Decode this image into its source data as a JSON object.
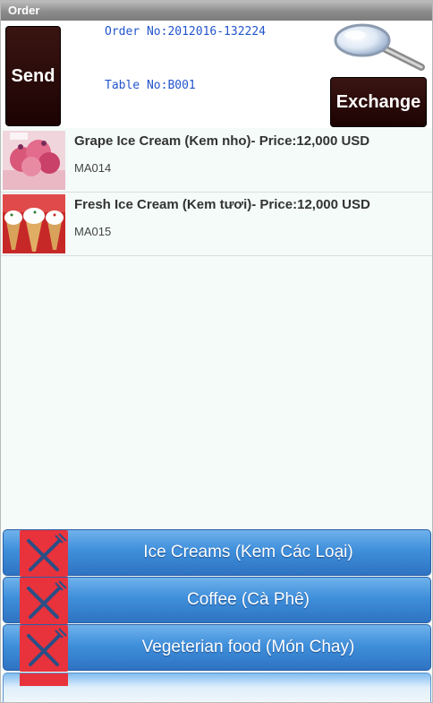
{
  "window": {
    "title": "Order"
  },
  "header": {
    "send_label": "Send",
    "order_no": "Order No:2012016-132224",
    "table_no": "Table No:B001",
    "exchange_label": "Exchange",
    "search_icon": "magnifier-icon"
  },
  "order_items": [
    {
      "title": "Grape Ice Cream (Kem nho)- Price:12,000 USD",
      "code": "MA014",
      "image": "grape-ice-cream-photo"
    },
    {
      "title": "Fresh Ice Cream (Kem  tươi)- Price:12,000 USD",
      "code": "MA015",
      "image": "fresh-ice-cream-photo"
    }
  ],
  "categories": [
    {
      "label": "Ice Creams (Kem Các Loại)",
      "icon": "fork-knife-icon"
    },
    {
      "label": "Coffee (Cà Phê)",
      "icon": "fork-knife-icon"
    },
    {
      "label": "Vegeterian food (Món Chay)",
      "icon": "fork-knife-icon"
    }
  ],
  "colors": {
    "dark_button": "#2a0b09",
    "category_blue": "#3f8fdb",
    "mono_text": "#2255cc",
    "icon_red": "#e8323c"
  }
}
